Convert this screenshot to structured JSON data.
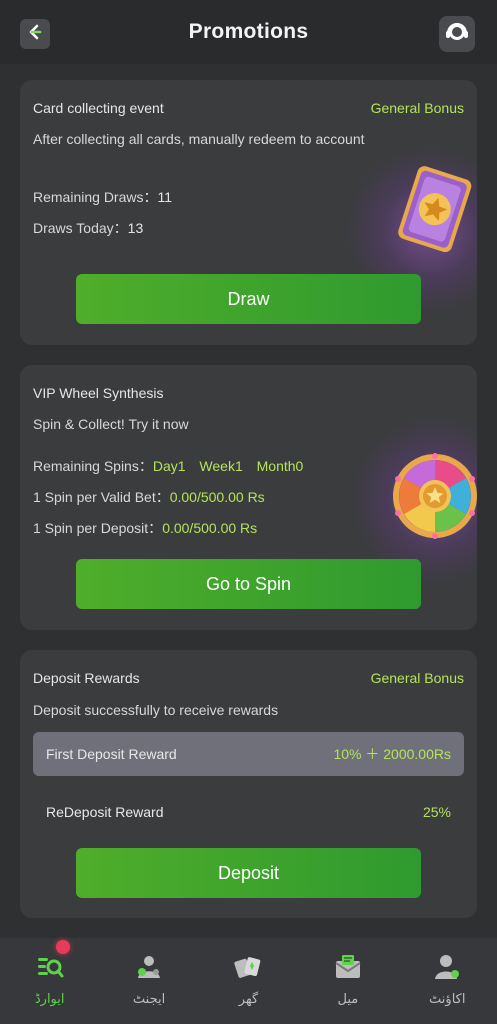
{
  "header": {
    "title": "Promotions",
    "back_icon": "back-arrow-icon",
    "support_icon": "headset-icon"
  },
  "card_event": {
    "title": "Card collecting event",
    "tag": "General Bonus",
    "description": "After collecting all cards, manually redeem to account",
    "remaining_draws_label": "Remaining Draws：",
    "remaining_draws_value": "11",
    "draws_today_label": "Draws Today：",
    "draws_today_value": "13",
    "button_label": "Draw",
    "art_icon": "star-card-icon"
  },
  "vip_wheel": {
    "title": "VIP Wheel Synthesis",
    "description": "Spin & Collect! Try it now",
    "remaining_spins_label": "Remaining Spins：",
    "spins": [
      "Day1",
      "Week1",
      "Month0"
    ],
    "per_bet_label": "1 Spin per Valid Bet：",
    "per_bet_value": "0.00/500.00 Rs",
    "per_deposit_label": "1 Spin per Deposit：",
    "per_deposit_value": "0.00/500.00 Rs",
    "button_label": "Go to Spin",
    "art_icon": "prize-wheel-icon"
  },
  "deposit_rewards": {
    "title": "Deposit Rewards",
    "tag": "General Bonus",
    "description": "Deposit successfully to receive rewards",
    "rows": [
      {
        "label": "First Deposit Reward",
        "value": "10% ＋ 2000.00Rs",
        "selected": true
      },
      {
        "label": "ReDeposit Reward",
        "value": "25%",
        "selected": false
      }
    ],
    "button_label": "Deposit"
  },
  "bottom_nav": [
    {
      "label": "ایوارڈ",
      "icon": "awards-search-icon",
      "active": true,
      "badge": true
    },
    {
      "label": "ایجنٹ",
      "icon": "agent-icon",
      "active": false
    },
    {
      "label": "گھر",
      "icon": "home-cards-icon",
      "active": false
    },
    {
      "label": "میل",
      "icon": "mail-icon",
      "active": false
    },
    {
      "label": "اکاؤنٹ",
      "icon": "account-icon",
      "active": false
    }
  ],
  "colors": {
    "accent_green": "#b4e35a",
    "button_green": "#3fa52c",
    "active_nav": "#5fd14a",
    "badge_red": "#e93a5a"
  }
}
